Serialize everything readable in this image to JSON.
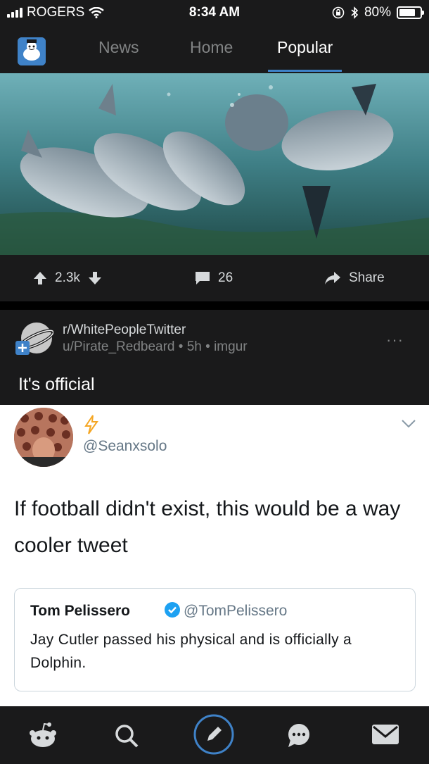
{
  "status_bar": {
    "carrier": "ROGERS",
    "time": "8:34 AM",
    "battery": "80%",
    "battery_level": 0.8
  },
  "nav": {
    "tabs": [
      {
        "label": "News",
        "active": false
      },
      {
        "label": "Home",
        "active": false
      },
      {
        "label": "Popular",
        "active": true
      }
    ],
    "accent": "#3f82c8"
  },
  "actions": {
    "upvotes": "2.3k",
    "comments": "26",
    "share_label": "Share"
  },
  "post": {
    "subreddit": "r/WhitePeopleTwitter",
    "author": "u/Pirate_Redbeard",
    "age": "5h",
    "domain": "imgur",
    "title": "It's official"
  },
  "tweet": {
    "handle": "@Seanxsolo",
    "text": "If football didn't exist, this would be a way cooler tweet",
    "quote": {
      "name": "Tom Pelissero",
      "handle": "@TomPelissero",
      "text": "Jay Cutler passed his physical and is officially a Dolphin."
    }
  },
  "bottom_nav": [
    "home-icon",
    "search-icon",
    "create-post-icon",
    "chat-icon",
    "inbox-icon"
  ]
}
